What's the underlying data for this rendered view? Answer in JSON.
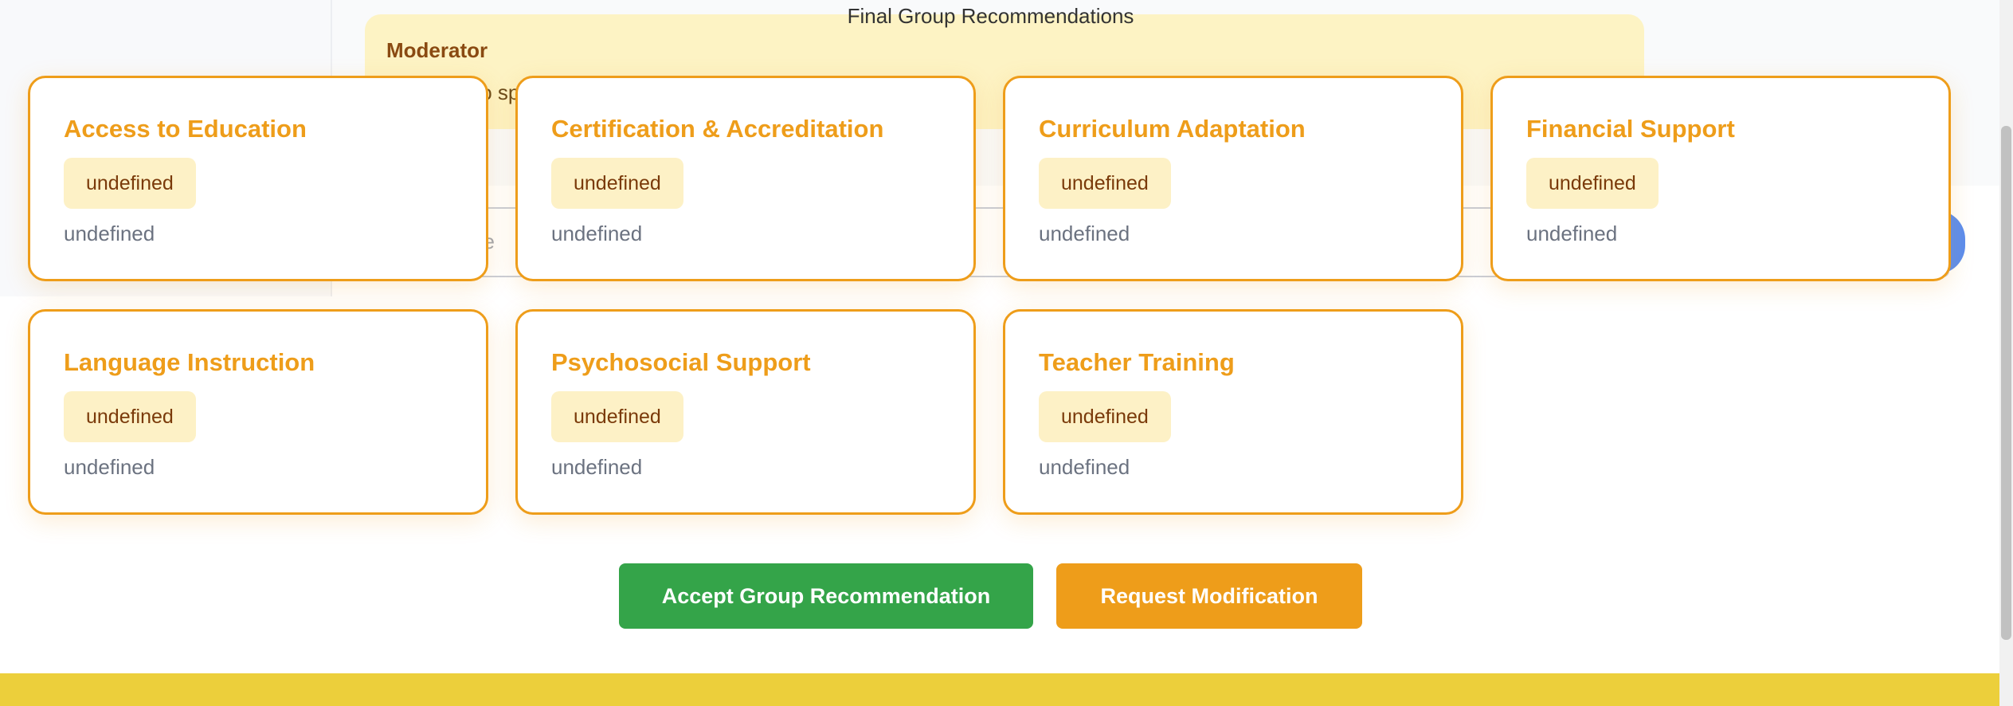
{
  "background": {
    "modal_title": "Final Group Recommendations",
    "moderator": {
      "label": "Moderator",
      "text_fragment": "fo                                                                    sp"
    },
    "input": {
      "placeholder_fragment": "pe"
    }
  },
  "cards": [
    {
      "title": "Access to Education",
      "badge": "undefined",
      "description": "undefined"
    },
    {
      "title": "Certification & Accreditation",
      "badge": "undefined",
      "description": "undefined"
    },
    {
      "title": "Curriculum Adaptation",
      "badge": "undefined",
      "description": "undefined"
    },
    {
      "title": "Financial Support",
      "badge": "undefined",
      "description": "undefined"
    },
    {
      "title": "Language Instruction",
      "badge": "undefined",
      "description": "undefined"
    },
    {
      "title": "Psychosocial Support",
      "badge": "undefined",
      "description": "undefined"
    },
    {
      "title": "Teacher Training",
      "badge": "undefined",
      "description": "undefined"
    }
  ],
  "actions": {
    "accept_label": "Accept Group Recommendation",
    "modify_label": "Request Modification"
  },
  "colors": {
    "accent_orange": "#ee9d1a",
    "badge_bg": "#fdf1c6",
    "accept_green": "#34a449",
    "footer_yellow": "#eccf3b",
    "moderator_bg": "#fdf3c4"
  }
}
